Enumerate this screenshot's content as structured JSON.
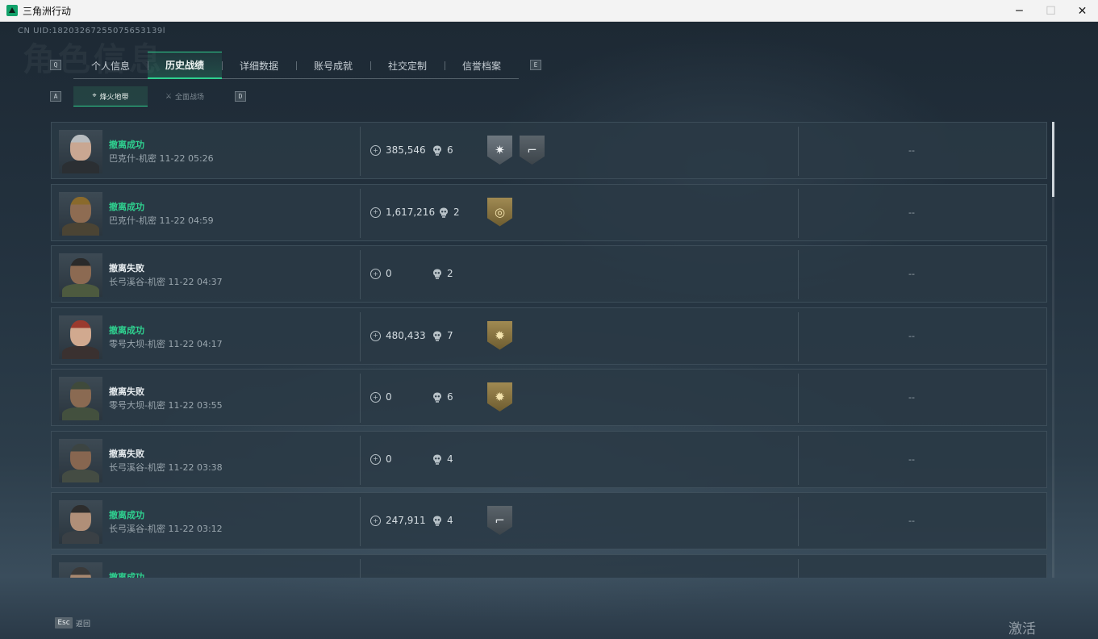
{
  "window": {
    "title": "三角洲行动",
    "minimize": "─",
    "maximize": "☐",
    "close": "✕"
  },
  "header": {
    "uid": "CN UID:18203267255075653139l",
    "bg_title": "角色信息"
  },
  "tabs": {
    "prev_key": "Q",
    "next_key": "E",
    "items": [
      {
        "label": "个人信息",
        "active": false
      },
      {
        "label": "历史战绩",
        "active": true
      },
      {
        "label": "详细数据",
        "active": false
      },
      {
        "label": "账号成就",
        "active": false
      },
      {
        "label": "社交定制",
        "active": false
      },
      {
        "label": "信誉档案",
        "active": false
      }
    ]
  },
  "subtabs": {
    "prev_key": "A",
    "next_key": "D",
    "items": [
      {
        "label": "烽火地带",
        "icon": "crosshair-icon",
        "active": true
      },
      {
        "label": "全面战场",
        "icon": "battlefield-icon",
        "active": false
      }
    ]
  },
  "records": [
    {
      "status": "撤离成功",
      "result": "success",
      "map": "巴克什-机密",
      "time": "11-22 05:26",
      "value": "385,546",
      "kills": "6",
      "medals": [
        "silver-star",
        "dark-gun"
      ],
      "extra": "--"
    },
    {
      "status": "撤离成功",
      "result": "success",
      "map": "巴克什-机密",
      "time": "11-22 04:59",
      "value": "1,617,216",
      "kills": "2",
      "medals": [
        "gold-target"
      ],
      "extra": "--"
    },
    {
      "status": "撤离失败",
      "result": "fail",
      "map": "长弓溪谷-机密",
      "time": "11-22 04:37",
      "value": "0",
      "kills": "2",
      "medals": [],
      "extra": "--"
    },
    {
      "status": "撤离成功",
      "result": "success",
      "map": "零号大坝-机密",
      "time": "11-22 04:17",
      "value": "480,433",
      "kills": "7",
      "medals": [
        "gold-sun"
      ],
      "extra": "--"
    },
    {
      "status": "撤离失败",
      "result": "fail",
      "map": "零号大坝-机密",
      "time": "11-22 03:55",
      "value": "0",
      "kills": "6",
      "medals": [
        "gold-sun"
      ],
      "extra": "--"
    },
    {
      "status": "撤离失败",
      "result": "fail",
      "map": "长弓溪谷-机密",
      "time": "11-22 03:38",
      "value": "0",
      "kills": "4",
      "medals": [],
      "extra": "--"
    },
    {
      "status": "撤离成功",
      "result": "success",
      "map": "长弓溪谷-机密",
      "time": "11-22 03:12",
      "value": "247,911",
      "kills": "4",
      "medals": [
        "dark-gun"
      ],
      "extra": "--"
    },
    {
      "status": "撤离成功",
      "result": "success",
      "map": "",
      "time": "",
      "value": "",
      "kills": "",
      "medals": [],
      "extra": ""
    }
  ],
  "footer": {
    "esc_key": "Esc",
    "esc_label": "返回"
  },
  "watermark": "激活 Windows",
  "colors": {
    "accent": "#2fd08f",
    "success": "#2fd08f",
    "fail": "#e7ecef"
  }
}
